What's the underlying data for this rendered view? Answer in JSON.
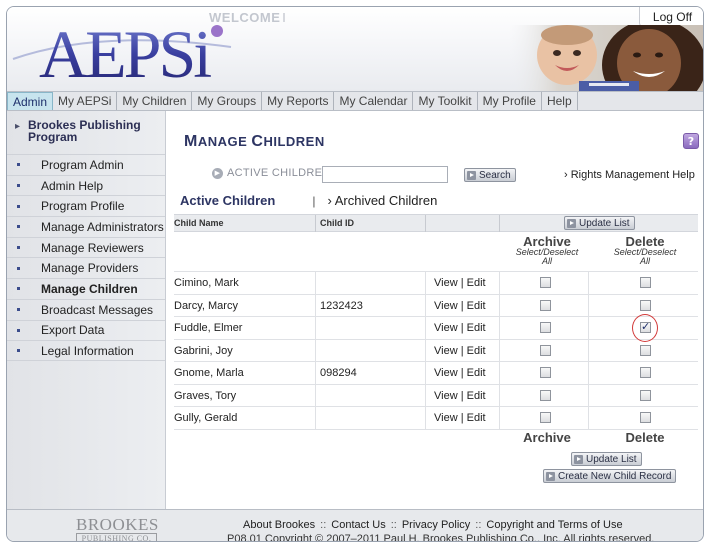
{
  "header": {
    "welcome": "WELCOME",
    "logo_text": "AEPSi",
    "logoff_label": "Log Off"
  },
  "nav": {
    "tabs": [
      {
        "label": "Admin",
        "active": true
      },
      {
        "label": "My AEPSi"
      },
      {
        "label": "My Children"
      },
      {
        "label": "My Groups"
      },
      {
        "label": "My Reports"
      },
      {
        "label": "My Calendar"
      },
      {
        "label": "My Toolkit"
      },
      {
        "label": "My Profile"
      },
      {
        "label": "Help"
      }
    ]
  },
  "sidebar": {
    "heading_line1": "Brookes Publishing",
    "heading_line2": "Program",
    "items": [
      {
        "label": "Program Admin"
      },
      {
        "label": "Admin Help"
      },
      {
        "label": "Program Profile"
      },
      {
        "label": "Manage Administrators"
      },
      {
        "label": "Manage Reviewers"
      },
      {
        "label": "Manage Providers"
      },
      {
        "label": "Manage Children",
        "current": true
      },
      {
        "label": "Broadcast Messages"
      },
      {
        "label": "Export Data"
      },
      {
        "label": "Legal Information"
      }
    ]
  },
  "main": {
    "title_first_big": "M",
    "title_rest_1": "ANAGE ",
    "title_second_big": "C",
    "title_rest_2": "HILDREN",
    "help_icon": "?",
    "active_children_label": "ACTIVE CHILDREN",
    "search_value": "",
    "search_button": "Search",
    "rights_help": "› Rights Management Help",
    "tab_active": "Active Children",
    "tab_separator": "|",
    "tab_archived": "› Archived Children",
    "columns": {
      "name": "Child Name",
      "id": "Child ID"
    },
    "update_list": "Update List",
    "archive_label": "Archive",
    "delete_label": "Delete",
    "select_deselect": "Select/Deselect",
    "all": "All",
    "view": "View",
    "pipe": "|",
    "edit": "Edit",
    "create_new": "Create New Child Record",
    "rows": [
      {
        "name": "Cimino, Mark",
        "id": "",
        "archive": false,
        "delete": false
      },
      {
        "name": "Darcy, Marcy",
        "id": "1232423",
        "archive": false,
        "delete": false
      },
      {
        "name": "Fuddle, Elmer",
        "id": "",
        "archive": false,
        "delete": true
      },
      {
        "name": "Gabrini, Joy",
        "id": "",
        "archive": false,
        "delete": false
      },
      {
        "name": "Gnome, Marla",
        "id": "098294",
        "archive": false,
        "delete": false
      },
      {
        "name": "Graves, Tory",
        "id": "",
        "archive": false,
        "delete": false
      },
      {
        "name": "Gully, Gerald",
        "id": "",
        "archive": false,
        "delete": false
      }
    ]
  },
  "footer": {
    "brookes_logo": "BROOKES",
    "brookes_sub": "PUBLISHING CO.",
    "links": [
      "About Brookes",
      "Contact Us",
      "Privacy Policy",
      "Copyright and Terms of Use"
    ],
    "link_sep": "::",
    "copyright": "P08.01 Copyright © 2007–2011 Paul H. Brookes Publishing Co., Inc. All rights reserved."
  },
  "colors": {
    "accent": "#2d3563",
    "active_tab": "#c7e4ee",
    "highlight_ring": "#d23a3a"
  }
}
